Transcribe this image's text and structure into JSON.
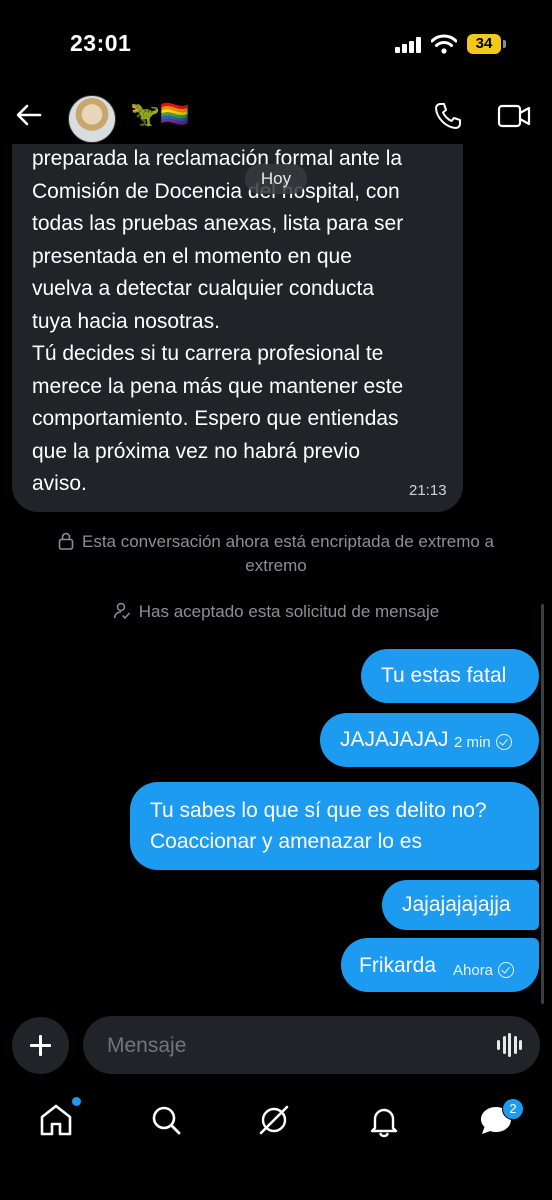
{
  "status_bar": {
    "time": "23:01",
    "battery": "34"
  },
  "header": {
    "name_emoji": "🦖🏳️‍🌈"
  },
  "conversation": {
    "date_divider": "Hoy",
    "received": {
      "text": "preparada la reclamación formal ante la\nComisión de Docencia del hospital, con\ntodas las pruebas anexas, lista para ser\npresentada en el momento en que\nvuelva a detectar cualquier conducta\ntuya hacia nosotras.\nTú decides si tu carrera profesional te\nmerece la pena más que mantener este\ncomportamiento. Espero que entiendas\nque la próxima vez no habrá previo\naviso.",
      "time": "21:13"
    },
    "encryption_notice": "Esta conversación ahora está encriptada de extremo a extremo",
    "accepted_notice": "Has aceptado esta solicitud de mensaje",
    "sent": [
      {
        "text": "Tu estas fatal"
      },
      {
        "text": "JAJAJAJAJ",
        "time": "2 min"
      },
      {
        "text": "Tu sabes lo que sí que es delito no?\nCoaccionar y amenazar lo es"
      },
      {
        "text": "Jajajajajajja"
      },
      {
        "text": "Frikarda",
        "time": "Ahora"
      }
    ]
  },
  "composer": {
    "placeholder": "Mensaje"
  },
  "bottom_nav": {
    "items": [
      "home-icon",
      "search-icon",
      "grok-icon",
      "notifications-icon",
      "messages-icon"
    ],
    "messages_badge": "2"
  },
  "colors": {
    "accent": "#1d9bf0",
    "bubble_received": "#202327",
    "background": "#000000"
  }
}
